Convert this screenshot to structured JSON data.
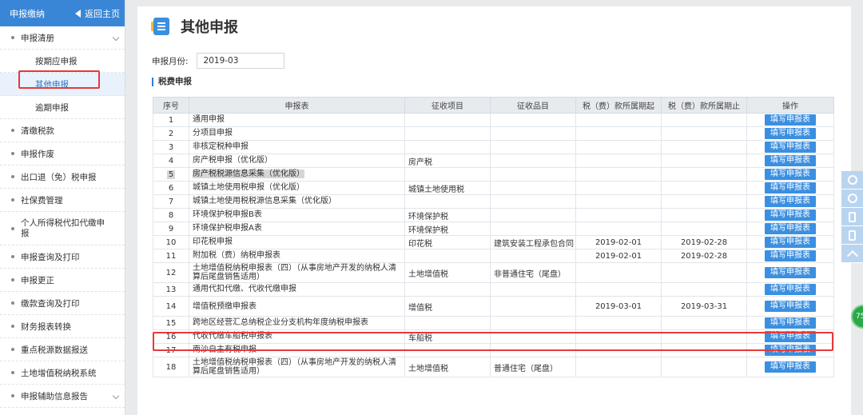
{
  "sidebar": {
    "header_title": "申报缴纳",
    "back_label": "返回主页",
    "items": [
      {
        "label": "申报清册",
        "expandable": true
      },
      {
        "label": "按期应申报",
        "sub": true
      },
      {
        "label": "其他申报",
        "sub": true,
        "active": true
      },
      {
        "label": "逾期申报",
        "sub": true
      },
      {
        "label": "清缴税款"
      },
      {
        "label": "申报作废"
      },
      {
        "label": "出口退（免）税申报"
      },
      {
        "label": "社保费管理"
      },
      {
        "label": "个人所得税代扣代缴申报"
      },
      {
        "label": "申报查询及打印"
      },
      {
        "label": "申报更正"
      },
      {
        "label": "缴款查询及打印"
      },
      {
        "label": "财务报表转换"
      },
      {
        "label": "重点税源数据报送"
      },
      {
        "label": "土地增值税纳税系统"
      },
      {
        "label": "申报辅助信息报告",
        "expandable": true
      }
    ]
  },
  "main": {
    "title": "其他申报",
    "month_label": "申报月份:",
    "month_value": "2019-03",
    "section_title": "税费申报"
  },
  "table": {
    "headers": [
      "序号",
      "申报表",
      "征收项目",
      "征收品目",
      "税（费）款所属期起",
      "税（费）款所属期止",
      "操作"
    ],
    "action_label": "填写申报表",
    "rows": [
      {
        "no": "1",
        "form": "通用申报",
        "item": "",
        "subitem": "",
        "start": "",
        "end": ""
      },
      {
        "no": "2",
        "form": "分项目申报",
        "item": "",
        "subitem": "",
        "start": "",
        "end": ""
      },
      {
        "no": "3",
        "form": "非核定税种申报",
        "item": "",
        "subitem": "",
        "start": "",
        "end": ""
      },
      {
        "no": "4",
        "form": "房产税申报（优化版）",
        "item": "房产税",
        "subitem": "",
        "start": "",
        "end": ""
      },
      {
        "no": "5",
        "form": "房产税税源信息采集（优化版）",
        "item": "",
        "subitem": "",
        "start": "",
        "end": "",
        "selected": true
      },
      {
        "no": "6",
        "form": "城镇土地使用税申报（优化版）",
        "item": "城镇土地使用税",
        "subitem": "",
        "start": "",
        "end": ""
      },
      {
        "no": "7",
        "form": "城镇土地使用税税源信息采集（优化版）",
        "item": "",
        "subitem": "",
        "start": "",
        "end": ""
      },
      {
        "no": "8",
        "form": "环境保护税申报B表",
        "item": "环境保护税",
        "subitem": "",
        "start": "",
        "end": ""
      },
      {
        "no": "9",
        "form": "环境保护税申报A表",
        "item": "环境保护税",
        "subitem": "",
        "start": "",
        "end": ""
      },
      {
        "no": "10",
        "form": "印花税申报",
        "item": "印花税",
        "subitem": "建筑安装工程承包合同",
        "start": "2019-02-01",
        "end": "2019-02-28"
      },
      {
        "no": "11",
        "form": "附加税（费）纳税申报表",
        "item": "",
        "subitem": "",
        "start": "2019-02-01",
        "end": "2019-02-28"
      },
      {
        "no": "12",
        "form": "土地增值税纳税申报表（四）（从事房地产开发的纳税人清算后尾盘销售适用）",
        "item": "土地增值税",
        "subitem": "非普通住宅（尾盘）",
        "start": "",
        "end": "",
        "tall": true
      },
      {
        "no": "13",
        "form": "通用代扣代缴、代收代缴申报",
        "item": "",
        "subitem": "",
        "start": "",
        "end": ""
      },
      {
        "no": "14",
        "form": "增值税预缴申报表",
        "item": "增值税",
        "subitem": "",
        "start": "2019-03-01",
        "end": "2019-03-31",
        "tall": true
      },
      {
        "no": "15",
        "form": "跨地区经营汇总纳税企业分支机构年度纳税申报表",
        "item": "",
        "subitem": "",
        "start": "",
        "end": ""
      },
      {
        "no": "16",
        "form": "代收代缴车船税申报表",
        "item": "车船税",
        "subitem": "",
        "start": "",
        "end": ""
      },
      {
        "no": "17",
        "form": "南沙自主有税申报",
        "item": "",
        "subitem": "",
        "start": "",
        "end": ""
      },
      {
        "no": "18",
        "form": "土地增值税纳税申报表（四）（从事房地产开发的纳税人清算后尾盘销售适用）",
        "item": "土地增值税",
        "subitem": "普通住宅（尾盘）",
        "start": "",
        "end": "",
        "tall": true
      }
    ]
  },
  "float_toolbar": {
    "icons": [
      "chat-icon",
      "weibo-icon",
      "mobile-icon",
      "tablet-icon",
      "scroll-top-icon"
    ],
    "badge_text": "75"
  },
  "colors": {
    "accent": "#3b8fe0",
    "sidebar_header": "#3a86d6",
    "highlight": "#e53a3a"
  }
}
